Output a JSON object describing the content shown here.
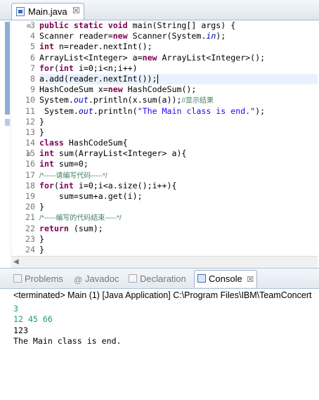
{
  "editor": {
    "tab": {
      "filename": "Main.java",
      "close": "☒"
    },
    "line_numbers": [
      "3",
      "4",
      "5",
      "6",
      "7",
      "8",
      "9",
      "10",
      "11",
      "12",
      "13",
      "14",
      "15",
      "16",
      "17",
      "18",
      "19",
      "20",
      "21",
      "22",
      "23",
      "24"
    ],
    "lines": {
      "l3_a": "public static void ",
      "l3_b": "main(String[] args) {",
      "l4_a": "Scanner reader=",
      "l4_kw": "new",
      "l4_b": " Scanner(System.",
      "l4_fld": "in",
      "l4_c": ");",
      "l5_kw": "int",
      "l5_b": " n=reader.nextInt();",
      "l6_a": "ArrayList<Integer> a=",
      "l6_kw": "new",
      "l6_b": " ArrayList<Integer>();",
      "l7_kw": "for",
      "l7_b": "(",
      "l7_kw2": "int",
      "l7_c": " i=0;i<n;i++)",
      "l8_a": "a.add(reader.nextInt());",
      "l9_a": "HashCodeSum x=",
      "l9_kw": "new",
      "l9_b": " HashCodeSum();",
      "l10_a": "System.",
      "l10_fld": "out",
      "l10_b": ".println(x.sum(a));",
      "l10_cm": "//显示结果",
      "l11_a": " System.",
      "l11_fld": "out",
      "l11_b": ".println(",
      "l11_str": "\"The Main class is end.\"",
      "l11_c": ");",
      "l12_a": "}",
      "l13_a": "}",
      "l14_kw": "class",
      "l14_b": " HashCodeSum{",
      "l15_kw": "int",
      "l15_b": " sum(ArrayList<Integer> a){",
      "l16_kw": "int",
      "l16_b": " sum=0;",
      "l17_cm": "/*-----请编写代码-----*/",
      "l18_kw": "for",
      "l18_b": "(",
      "l18_kw2": "int",
      "l18_c": " i=0;i<a.size();i++){",
      "l19_a": "    sum=sum+a.get(i);",
      "l20_a": "}",
      "l21_cm": "/*-----编写的代码结束-----*/",
      "l22_kw": "return",
      "l22_b": " (sum);",
      "l23_a": "}",
      "l24_a": "}"
    }
  },
  "views": {
    "tabs": [
      "Problems",
      "Javadoc",
      "Declaration",
      "Console"
    ],
    "javadoc_symbol": "@",
    "active": "Console",
    "close": "☒"
  },
  "console": {
    "info": "<terminated> Main (1) [Java Application] C:\\Program Files\\IBM\\TeamConcert",
    "output": [
      "3",
      "12 45 66",
      "123",
      "The Main class is end."
    ],
    "colors": {
      "input": "#1c9e62",
      "output": "#000000"
    }
  }
}
